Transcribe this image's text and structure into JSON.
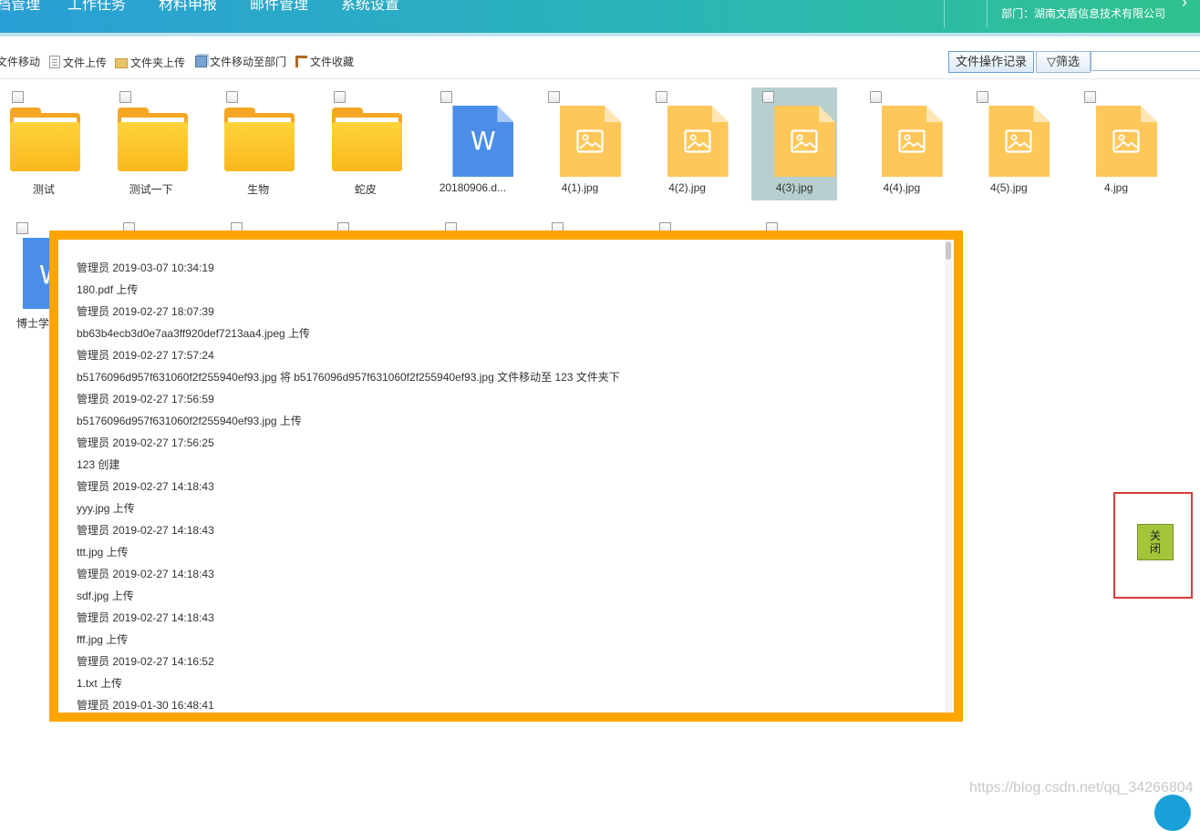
{
  "nav": {
    "items": [
      "档管理",
      "工作任务",
      "材料申报",
      "邮件管理",
      "系统设置"
    ],
    "user_dept": "部门：湖南文盾信息技术有限公司"
  },
  "toolbar": {
    "move_label": "文件移动",
    "upload_label": "文件上传",
    "folder_upload_label": "文件夹上传",
    "move_to_dept_label": "文件移动至部门",
    "favorite_label": "文件收藏",
    "log_label": "文件操作记录",
    "filter_label": "筛选",
    "search_value": ""
  },
  "files": [
    {
      "name": "测试",
      "type": "folder"
    },
    {
      "name": "测试一下",
      "type": "folder"
    },
    {
      "name": "生物",
      "type": "folder"
    },
    {
      "name": "蛇皮",
      "type": "folder"
    },
    {
      "name": "20180906.d...",
      "type": "word",
      "letter": "W"
    },
    {
      "name": "4(1).jpg",
      "type": "image"
    },
    {
      "name": "4(2).jpg",
      "type": "image"
    },
    {
      "name": "4(3).jpg",
      "type": "image",
      "selected": true
    },
    {
      "name": "4(4).jpg",
      "type": "image"
    },
    {
      "name": "4(5).jpg",
      "type": "image"
    },
    {
      "name": "4.jpg",
      "type": "image"
    }
  ],
  "row2": {
    "partial_letter": "W",
    "partial_label": "博士学"
  },
  "log": {
    "lines": [
      "管理员 2019-03-07 10:34:19",
      "180.pdf 上传",
      "管理员 2019-02-27 18:07:39",
      "bb63b4ecb3d0e7aa3ff920def7213aa4.jpeg 上传",
      "管理员 2019-02-27 17:57:24",
      "b5176096d957f631060f2f255940ef93.jpg 将 b5176096d957f631060f2f255940ef93.jpg 文件移动至 123 文件夹下",
      "管理员 2019-02-27 17:56:59",
      "b5176096d957f631060f2f255940ef93.jpg 上传",
      "管理员 2019-02-27 17:56:25",
      "123 创建",
      "管理员 2019-02-27 14:18:43",
      "yyy.jpg 上传",
      "管理员 2019-02-27 14:18:43",
      "ttt.jpg 上传",
      "管理员 2019-02-27 14:18:43",
      "sdf.jpg 上传",
      "管理员 2019-02-27 14:18:43",
      "fff.jpg 上传",
      "管理员 2019-02-27 14:16:52",
      "1.txt 上传",
      "管理员 2019-01-30 16:48:41"
    ]
  },
  "close_button": {
    "line1": "关",
    "line2": "闭"
  },
  "watermark": "https://blog.csdn.net/qq_34266804",
  "colors": {
    "accent_orange": "#ffa500",
    "close_green": "#a4c43a",
    "highlight_red": "#e03a3a"
  }
}
